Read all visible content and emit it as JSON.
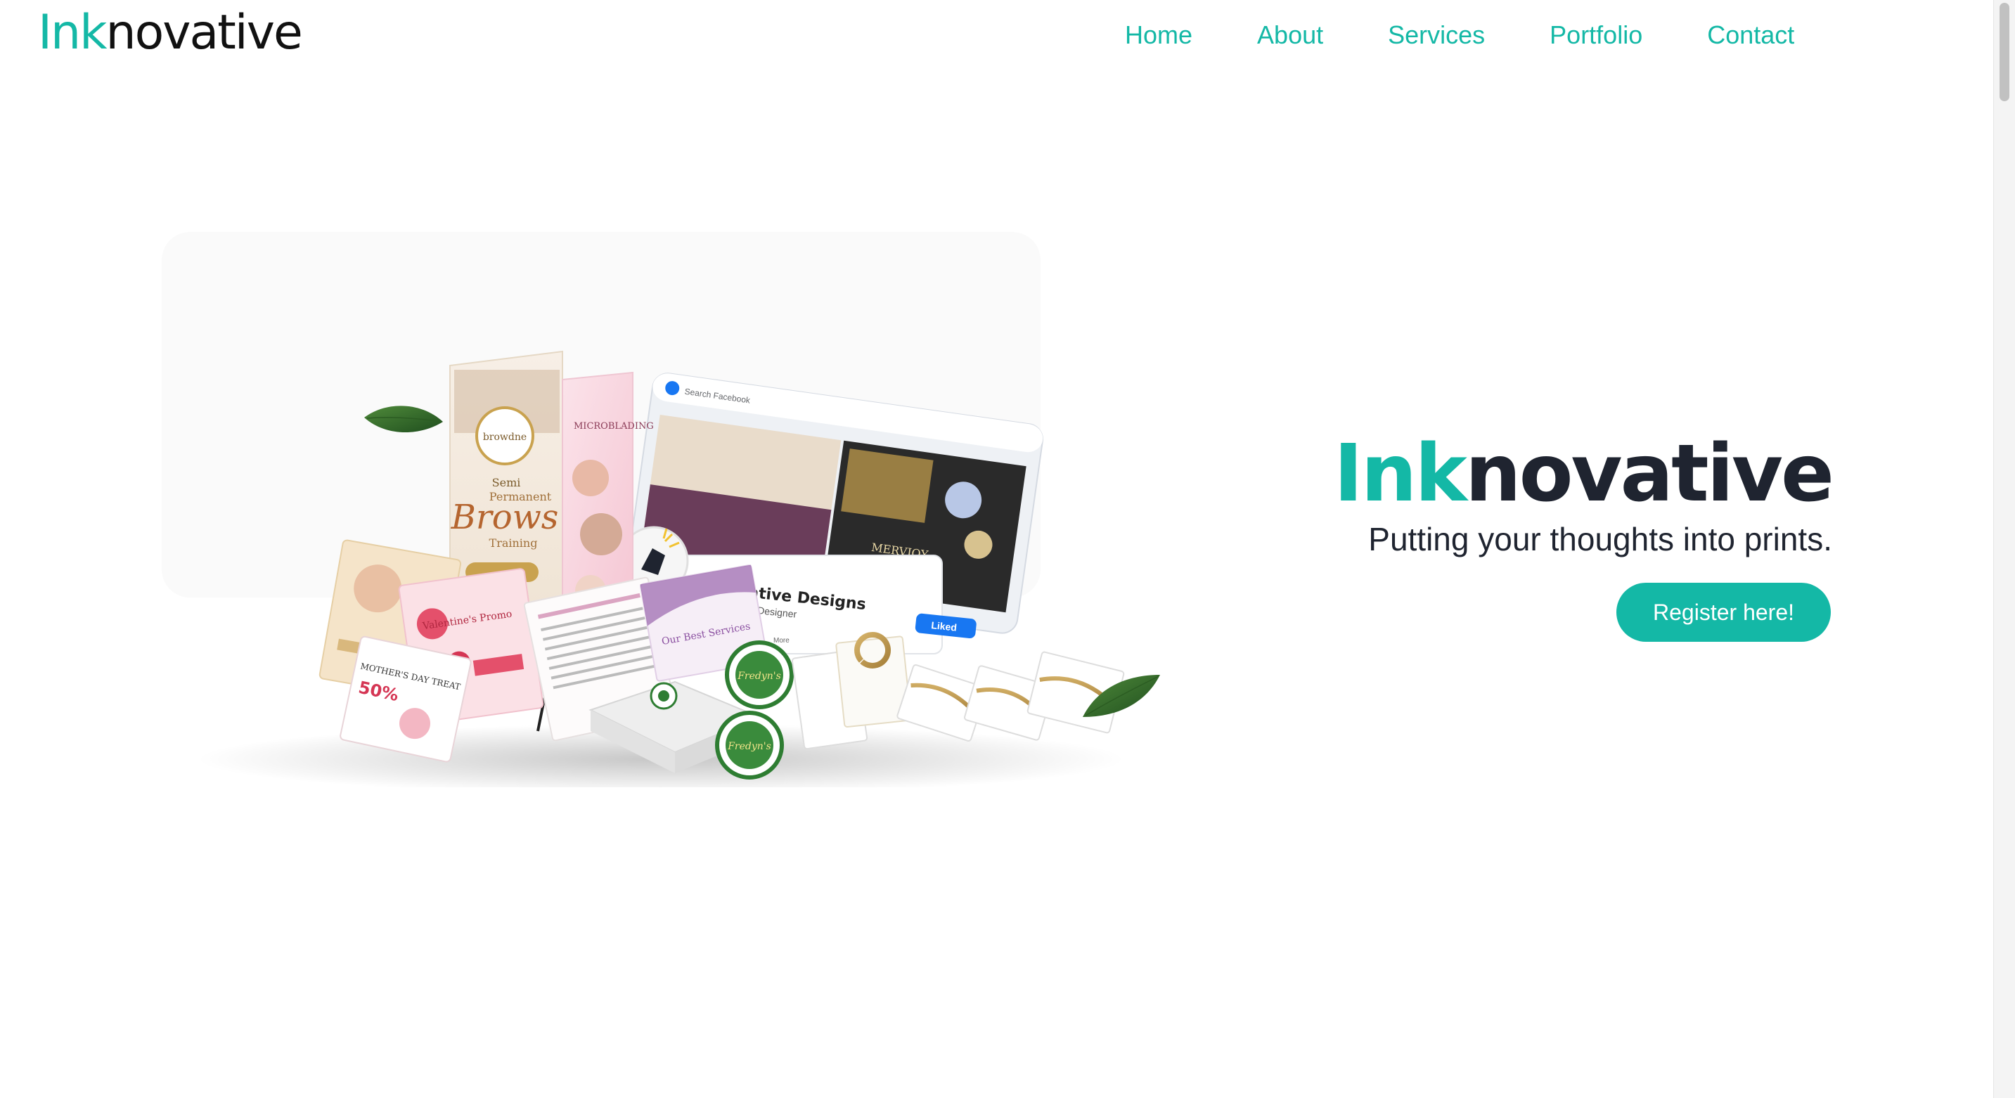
{
  "header": {
    "brand_prefix": "Ink",
    "brand_suffix": "novative"
  },
  "nav": {
    "items": [
      {
        "label": "Home"
      },
      {
        "label": "About"
      },
      {
        "label": "Services"
      },
      {
        "label": "Portfolio"
      },
      {
        "label": "Contact"
      }
    ]
  },
  "hero": {
    "title_prefix": "Ink",
    "title_suffix": "novative",
    "tagline": "Putting your thoughts into prints.",
    "cta_label": "Register here!",
    "collage": {
      "stand_top": "Semi",
      "stand_mid": "Permanent",
      "stand_main": "Brows",
      "stand_sub": "Training",
      "stand_logo": "browdne",
      "banner2": "MICROBLADING",
      "fb_search": "Search Facebook",
      "profile_name": "CLCreative Designs",
      "profile_subtitle": "Web/Graphic Designer",
      "liked_label": "Liked",
      "flyer_valentine": "Valentine's Promo",
      "flyer_mothers": "MOTHER'S DAY TREAT",
      "flyer_mothers_pct": "50%",
      "badge_name": "Fredyn's",
      "services_label": "Our Best Services",
      "more_label": "More"
    }
  },
  "colors": {
    "accent": "#14b8a6",
    "heading": "#1f2430",
    "background": "#ffffff"
  }
}
